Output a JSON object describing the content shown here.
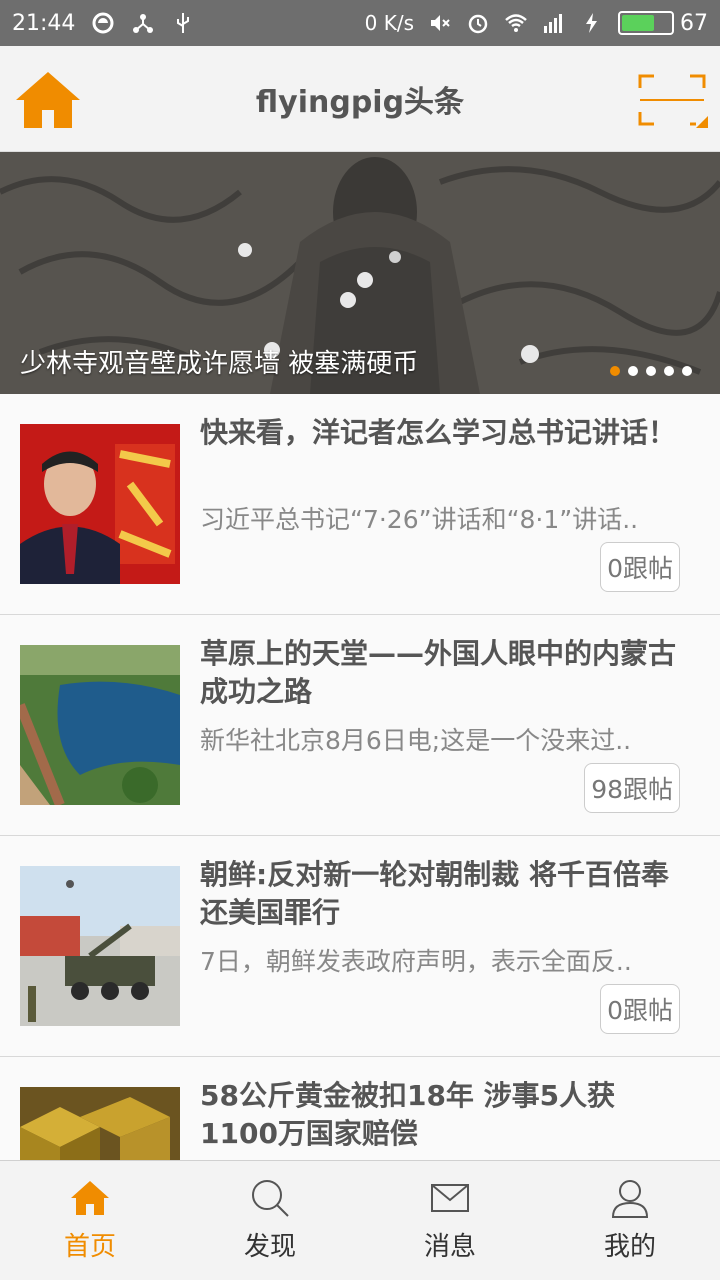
{
  "statusbar": {
    "time": "21:44",
    "network_speed": "0 K/s",
    "battery_level": "67",
    "battery_fraction": 0.67,
    "battery_color": "#5bd15b"
  },
  "header": {
    "title": "flyingpig头条",
    "home_icon": "home-icon",
    "scan_icon": "scan-icon",
    "accent_color": "#f08c00"
  },
  "banner": {
    "caption": "少林寺观音壁成许愿墙 被塞满硬币",
    "slides_total": 5,
    "active_slide": 1
  },
  "news": [
    {
      "title": "快来看，洋记者怎么学习总书记讲话！",
      "summary": "习近平总书记“7·26”讲话和“8·1”讲话..",
      "replies": "0跟帖"
    },
    {
      "title": "草原上的天堂——外国人眼中的内蒙古成功之路",
      "summary": "新华社北京8月6日电;这是一个没来过..",
      "replies": "98跟帖"
    },
    {
      "title": "朝鲜:反对新一轮对朝制裁 将千百倍奉还美国罪行",
      "summary": "7日，朝鲜发表政府声明，表示全面反..",
      "replies": "0跟帖"
    },
    {
      "title": "58公斤黄金被扣18年 涉事5人获1100万国家赔偿",
      "summary": "",
      "replies": ""
    }
  ],
  "tabs": [
    {
      "label": "首页",
      "icon": "home-icon",
      "active": true
    },
    {
      "label": "发现",
      "icon": "search-icon",
      "active": false
    },
    {
      "label": "消息",
      "icon": "mail-icon",
      "active": false
    },
    {
      "label": "我的",
      "icon": "user-icon",
      "active": false
    }
  ]
}
